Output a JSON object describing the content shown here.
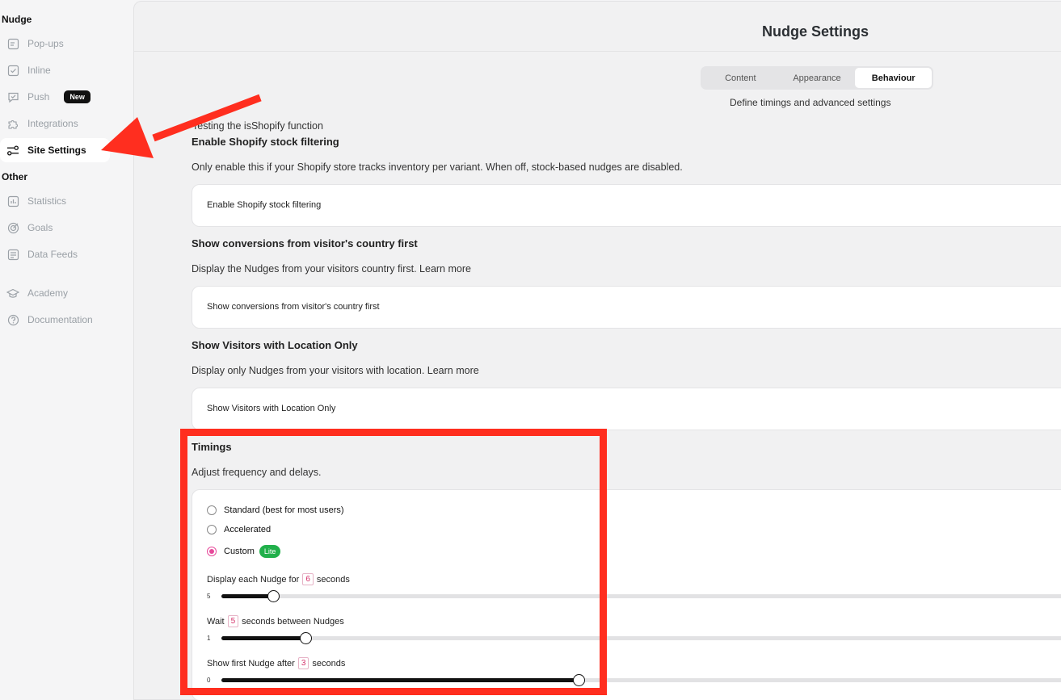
{
  "sidebar": {
    "section_nudge": "Nudge",
    "section_other": "Other",
    "items": [
      {
        "label": "Pop-ups",
        "icon": "popup-icon"
      },
      {
        "label": "Inline",
        "icon": "inline-icon"
      },
      {
        "label": "Push",
        "icon": "push-icon",
        "badge": "New"
      },
      {
        "label": "Integrations",
        "icon": "puzzle-icon"
      },
      {
        "label": "Site Settings",
        "icon": "settings-sliders-icon",
        "active": true
      },
      {
        "label": "Statistics",
        "icon": "statistics-icon"
      },
      {
        "label": "Goals",
        "icon": "target-icon"
      },
      {
        "label": "Data Feeds",
        "icon": "data-feed-icon"
      },
      {
        "label": "Academy",
        "icon": "graduation-cap-icon"
      },
      {
        "label": "Documentation",
        "icon": "help-circle-icon"
      }
    ]
  },
  "header": {
    "title": "Nudge Settings"
  },
  "tabs": {
    "items": [
      "Content",
      "Appearance",
      "Behaviour"
    ],
    "active": "Behaviour",
    "description": "Define timings and advanced settings"
  },
  "settings": {
    "debug_text": "Testing the isShopify function",
    "shopify": {
      "title": "Enable Shopify stock filtering",
      "description": "Only enable this if your Shopify store tracks inventory per variant. When off, stock-based nudges are disabled.",
      "toggle_label": "Enable Shopify stock filtering"
    },
    "country": {
      "title": "Show conversions from visitor's country first",
      "description": "Display the Nudges from your visitors country first. Learn more",
      "toggle_label": "Show conversions from visitor's country first"
    },
    "location": {
      "title": "Show Visitors with Location Only",
      "description": "Display only Nudges from your visitors with location. Learn more",
      "toggle_label": "Show Visitors with Location Only"
    }
  },
  "timings": {
    "title": "Timings",
    "description": "Adjust frequency and delays.",
    "options": [
      {
        "label": "Standard (best for most users)",
        "selected": false
      },
      {
        "label": "Accelerated",
        "selected": false
      },
      {
        "label": "Custom",
        "selected": true,
        "badge": "Lite"
      }
    ],
    "sliders": [
      {
        "prefix": "Display each Nudge for",
        "value": "6",
        "suffix": "seconds",
        "min": "5",
        "fill_fraction": 0.06
      },
      {
        "prefix": "Wait",
        "value": "5",
        "suffix": "seconds between Nudges",
        "min": "1",
        "fill_fraction": 0.097
      },
      {
        "prefix": "Show first Nudge after",
        "value": "3",
        "suffix": "seconds",
        "min": "0",
        "fill_fraction": 0.413
      }
    ]
  },
  "colors": {
    "accent": "#e6499a",
    "lite_badge": "#21b04b",
    "annotation": "#ff2e1f"
  }
}
